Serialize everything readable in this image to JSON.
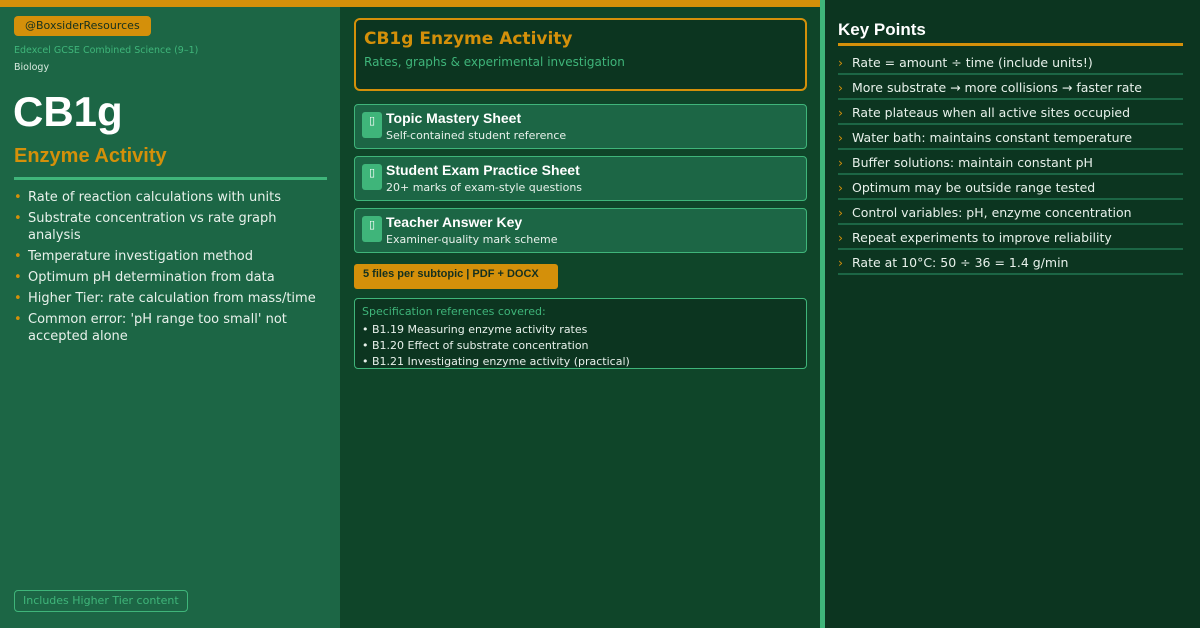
{
  "handle": "@BoxsiderResources",
  "spec": "Edexcel GCSE Combined Science (9–1)",
  "subject": "Biology",
  "code": "CB1g",
  "topic": "Enzyme Activity",
  "bullets": [
    "Rate of reaction calculations with units",
    "Substrate concentration vs rate graph analysis",
    "Temperature investigation method",
    "Optimum pH determination from data",
    "Higher Tier: rate calculation from mass/time",
    "Common error: 'pH range too small' not accepted alone"
  ],
  "higher_tier": "Includes Higher Tier content",
  "main_title": "CB1g Enzyme Activity",
  "main_subtitle": "Rates, graphs & experimental investigation",
  "cards": [
    {
      "title": "Topic Mastery Sheet",
      "subtitle": "Self-contained student reference",
      "icon": "document-icon"
    },
    {
      "title": "Student Exam Practice Sheet",
      "subtitle": "20+ marks of exam-style questions",
      "icon": "document-icon"
    },
    {
      "title": "Teacher Answer Key",
      "subtitle": "Examiner-quality mark scheme",
      "icon": "document-icon"
    }
  ],
  "files_badge": "5 files per subtopic  |  PDF + DOCX",
  "spec_refs": {
    "heading": "Specification references covered:",
    "items": [
      "• B1.19  Measuring enzyme activity rates",
      "• B1.20  Effect of substrate concentration",
      "• B1.21  Investigating enzyme activity (practical)"
    ]
  },
  "key_points": {
    "title": "Key Points",
    "items": [
      "Rate = amount ÷ time (include units!)",
      "More substrate → more collisions → faster rate",
      "Rate plateaus when all active sites occupied",
      "Water bath: maintains constant temperature",
      "Buffer solutions: maintain constant pH",
      "Optimum may be outside range tested",
      "Control variables: pH, enzyme concentration",
      "Repeat experiments to improve reliability",
      "Rate at 10°C: 50 ÷ 36 = 1.4 g/min"
    ]
  },
  "colors": {
    "accent": "#d4900a",
    "green_light": "#3fb57a",
    "panel_left": "#1c6645",
    "panel_dark": "#0c3520"
  }
}
